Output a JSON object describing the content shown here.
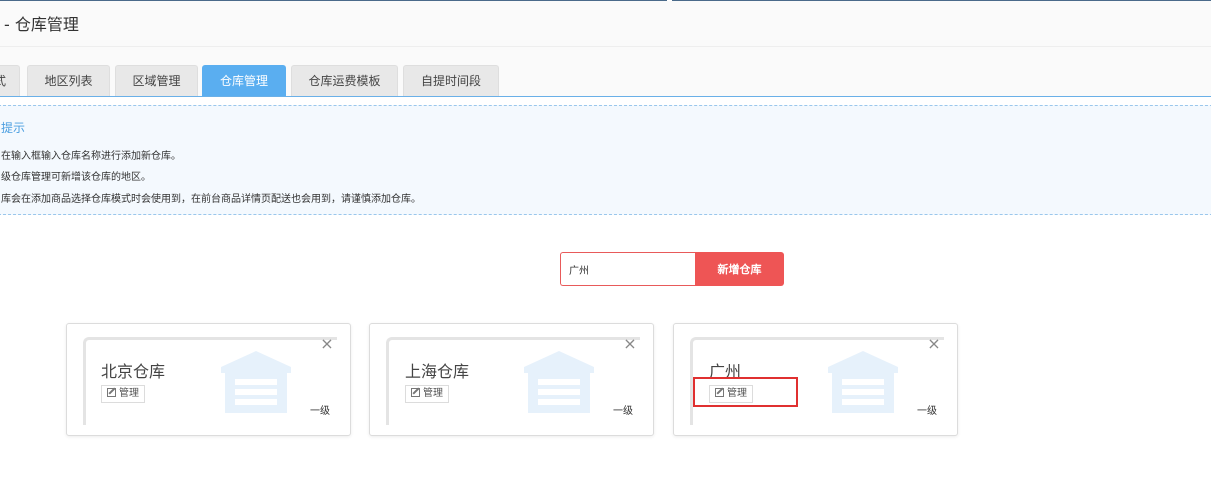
{
  "header": {
    "title": "- 仓库管理"
  },
  "tabs": [
    {
      "label": "式"
    },
    {
      "label": "地区列表"
    },
    {
      "label": "区域管理"
    },
    {
      "label": "仓库管理",
      "active": true
    },
    {
      "label": "仓库运费模板"
    },
    {
      "label": "自提时间段"
    }
  ],
  "tips": {
    "title": "提示",
    "lines": [
      "在输入框输入仓库名称进行添加新仓库。",
      "级仓库管理可新增该仓库的地区。",
      "库会在添加商品选择仓库模式时会使用到，在前台商品详情页配送也会用到，请谨慎添加仓库。"
    ]
  },
  "add_form": {
    "input_value": "广州",
    "button_label": "新增仓库",
    "button_color": "#ee5555"
  },
  "warehouses": [
    {
      "name": "北京仓库",
      "manage_label": "管理",
      "level": "一级",
      "close": "×"
    },
    {
      "name": "上海仓库",
      "manage_label": "管理",
      "level": "一级",
      "close": "×"
    },
    {
      "name": "广州",
      "manage_label": "管理",
      "level": "一级",
      "close": "×"
    }
  ],
  "colors": {
    "accent": "#5aaef0",
    "danger": "#ee5555",
    "highlight": "#e03030",
    "icon_watermark": "#e6f1fb"
  },
  "icons": {
    "edit": "edit-icon",
    "close": "close-icon",
    "warehouse": "warehouse-icon"
  }
}
